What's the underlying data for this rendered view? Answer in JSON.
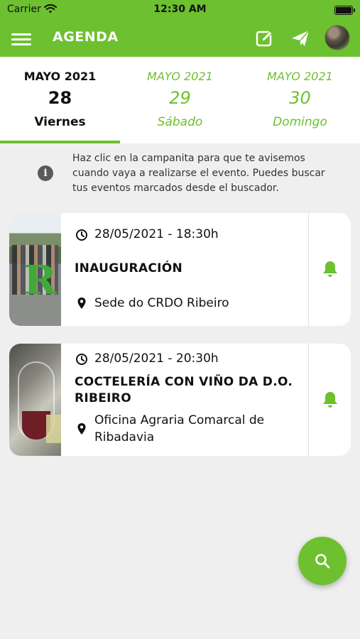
{
  "status_bar": {
    "carrier": "Carrier",
    "time": "12:30 AM"
  },
  "app_bar": {
    "title": "AGENDA",
    "icons": [
      "menu-icon",
      "edit-icon",
      "send-icon",
      "avatar"
    ]
  },
  "date_tabs": [
    {
      "month": "MAYO 2021",
      "day": "28",
      "weekday": "Viernes",
      "active": true
    },
    {
      "month": "MAYO 2021",
      "day": "29",
      "weekday": "Sábado",
      "active": false
    },
    {
      "month": "MAYO 2021",
      "day": "30",
      "weekday": "Domingo",
      "active": false
    }
  ],
  "info": {
    "lines": [
      "Haz clic en la campanita para que te avisemos",
      "cuando vaya a realizarse el evento. Puedes buscar",
      "tus eventos marcados desde el buscador."
    ]
  },
  "events": [
    {
      "datetime": "28/05/2021 - 18:30h",
      "title_lines": [
        "INAUGURACIÓN"
      ],
      "place_lines": [
        "Sede do CRDO Ribeiro"
      ]
    },
    {
      "datetime": "28/05/2021 - 20:30h",
      "title_lines": [
        "COCTELERÍA CON VIÑO DA D.O.",
        "RIBEIRO"
      ],
      "place_lines": [
        "Oficina Agraria Comarcal de",
        "Ribadavia"
      ]
    }
  ],
  "colors": {
    "accent": "#6dc02f",
    "background": "#efefef",
    "card": "#ffffff",
    "text": "#111111"
  },
  "fab": {
    "icon": "search-icon"
  }
}
